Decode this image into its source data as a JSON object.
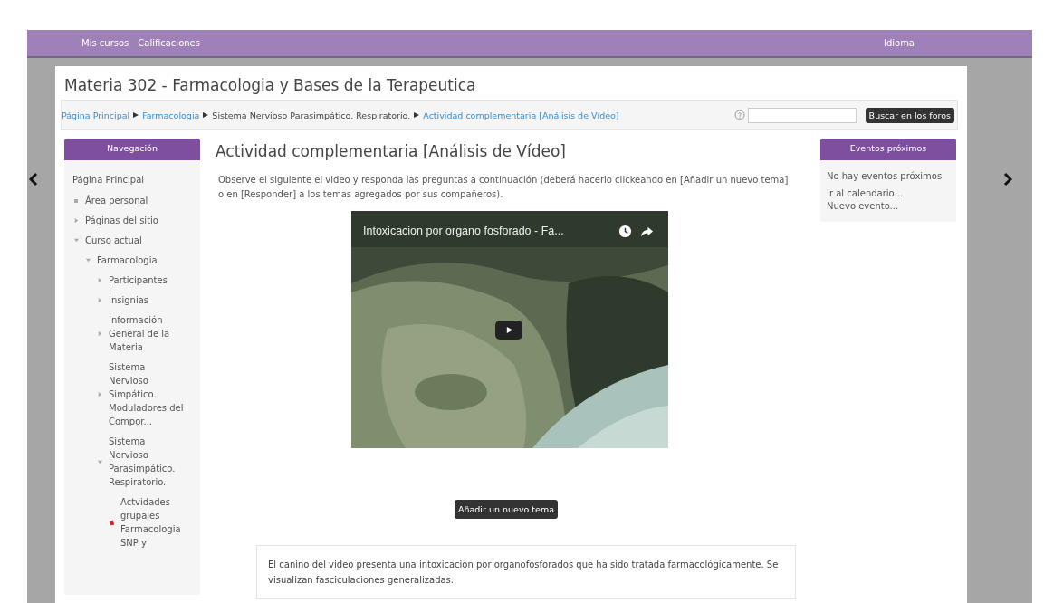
{
  "top_bar": {
    "links": [
      "Mis cursos",
      "Calificaciones"
    ],
    "language": "Idioma"
  },
  "course_title": "Materia 302 - Farmacologia y Bases de la Terapeutica",
  "breadcrumb": [
    {
      "label": "Página Principal",
      "link": true
    },
    {
      "label": "Farmacologia",
      "link": true
    },
    {
      "label": "Sistema Nervioso Parasimpático. Respiratorio.",
      "link": false
    },
    {
      "label": "Actividad complementaria [Análisis de Vídeo]",
      "link": true
    }
  ],
  "search": {
    "button": "Buscar en los foros"
  },
  "navigation": {
    "title": "Navegación",
    "items": [
      {
        "label": "Página Principal",
        "kind": "plain"
      },
      {
        "label": "Área personal",
        "kind": "bullet"
      },
      {
        "label": "Páginas del sitio",
        "kind": "collapsed"
      },
      {
        "label": "Curso actual",
        "kind": "expanded",
        "children": [
          {
            "label": "Farmacologia",
            "kind": "expanded",
            "children": [
              {
                "label": "Participantes",
                "kind": "collapsed"
              },
              {
                "label": "Insignias",
                "kind": "collapsed"
              },
              {
                "label": "Información General de la Materia",
                "kind": "collapsed"
              },
              {
                "label": "Sistema Nervioso Simpático. Moduladores del Compor...",
                "kind": "collapsed"
              },
              {
                "label": "Sistema Nervioso Parasimpático. Respiratorio.",
                "kind": "expanded",
                "children": [
                  {
                    "label": "Actvidades grupales Farmacologia SNP y",
                    "kind": "activity"
                  }
                ]
              }
            ]
          }
        ]
      }
    ]
  },
  "main": {
    "title": "Actividad complementaria [Análisis de Vídeo]",
    "intro": "Observe el siguiente el video y responda las preguntas a continuación (deberá hacerlo clickeando en [Añadir un nuevo tema] o en [Responder] a los temas agregados por sus compañeros).",
    "video": {
      "title": "Intoxicacion por organo fosforado - Fa..."
    },
    "add_button": "Añadir un nuevo tema",
    "post": "El canino del video presenta una intoxicación por organofosforados que ha sido tratada farmacológicamente. Se visualizan fasciculaciones generalizadas."
  },
  "events": {
    "title": "Eventos próximos",
    "empty": "No hay eventos próximos",
    "links": [
      "Ir al calendario...",
      "Nuevo evento..."
    ]
  }
}
